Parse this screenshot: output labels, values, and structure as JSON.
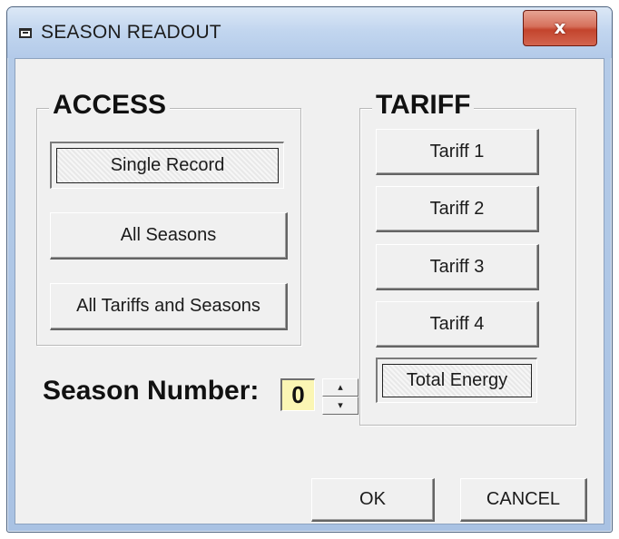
{
  "window": {
    "title": "SEASON READOUT",
    "close_glyph": "x"
  },
  "access": {
    "title": "ACCESS",
    "buttons": [
      {
        "label": "Single Record",
        "selected": true
      },
      {
        "label": "All Seasons",
        "selected": false
      },
      {
        "label": "All Tariffs and Seasons",
        "selected": false
      }
    ]
  },
  "tariff": {
    "title": "TARIFF",
    "buttons": [
      {
        "label": "Tariff 1"
      },
      {
        "label": "Tariff 2"
      },
      {
        "label": "Tariff 3"
      },
      {
        "label": "Tariff 4"
      },
      {
        "label": "Total Energy",
        "selected": true
      }
    ]
  },
  "season": {
    "label": "Season Number:",
    "value": "0",
    "up_glyph": "▴",
    "down_glyph": "▾"
  },
  "footer": {
    "ok_label": "OK",
    "cancel_label": "CANCEL"
  },
  "icons": {
    "title_icon": "window-app-icon",
    "close_icon": "close-x-icon"
  },
  "colors": {
    "close_button": "#c3442d",
    "season_field_bg": "#fbf6b4",
    "dialog_bg": "#f0f0f0",
    "frame": "#b4cbe8"
  }
}
